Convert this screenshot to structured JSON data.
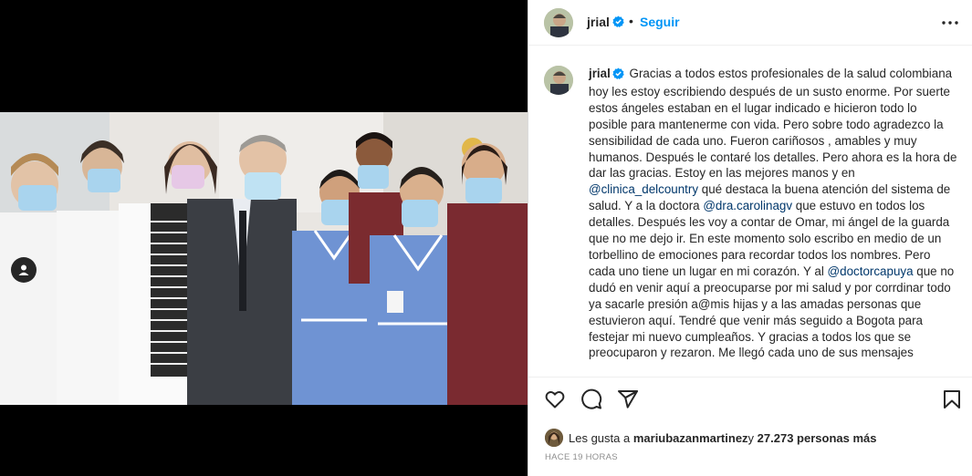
{
  "post": {
    "username": "jrial",
    "separator": "•",
    "follow_label": "Seguir",
    "caption": {
      "username": "jrial",
      "text_1": " Gracias a todos estos profesionales de la salud colombiana hoy les estoy escribiendo después de un susto enorme. Por suerte estos ángeles estaban en el lugar indicado e hicieron todo lo posible para mantenerme con vida. Pero sobre todo agradezco la sensibilidad de cada uno. Fueron cariñosos , amables y muy humanos. Después le contaré los detalles. Pero ahora es la hora de dar las gracias. Estoy en las mejores manos y en ",
      "mention_1": "@clinica_delcountry",
      "text_2": " qué destaca la buena atención del sistema de salud. Y a la doctora ",
      "mention_2": "@dra.carolinagv",
      "text_3": " que estuvo en todos los detalles. Después les voy a contar de Omar, mi ángel de la guarda que no me dejo ir. En este momento solo escribo en medio de un torbellino de emociones para recordar todos los nombres. Pero cada uno tiene un lugar en mi corazón. Y al ",
      "mention_3": "@doctorcapuya",
      "text_4": " que no dudó en venir aquí a preocuparse por mi salud y por corrdinar todo ya sacarle presión a@mis hijas y a las amadas personas que estuvieron aquí. Tendré que venir más seguido a Bogota para festejar mi nuevo cumpleaños. Y gracias a todos los que se preocuparon y rezaron. Me llegó cada uno de sus mensajes"
    },
    "likes": {
      "prefix": "Les gusta a ",
      "user": "mariubazanmartinez",
      "middle": " y ",
      "count": "27.273 personas más"
    },
    "time": "HACE 19 HORAS"
  },
  "icons": {
    "more": "more-horizontal-icon",
    "like": "heart-icon",
    "comment": "comment-icon",
    "share": "paper-plane-icon",
    "save": "bookmark-icon",
    "user_tag": "person-icon",
    "verified": "verified-badge-icon"
  },
  "colors": {
    "accent": "#0095f6",
    "verified": "#0095f6",
    "mention": "#00376b",
    "muted": "#8e8e8e"
  }
}
